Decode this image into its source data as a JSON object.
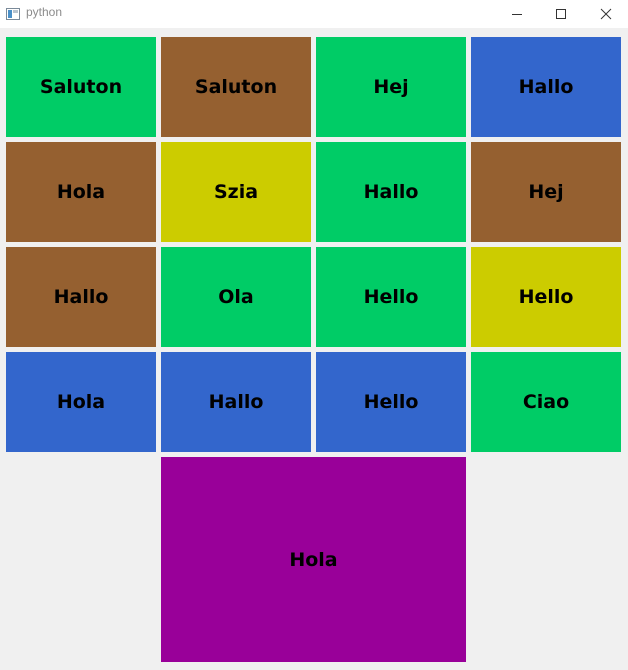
{
  "window": {
    "title": "python",
    "icons": {
      "app": "python-app-icon",
      "minimize": "minimize-icon",
      "maximize": "maximize-icon",
      "close": "close-icon"
    }
  },
  "colors": {
    "green": "#00cc66",
    "brown": "#956030",
    "blue": "#3366cc",
    "yellow": "#cccc00",
    "purple": "#990099",
    "background": "#f0f0f0"
  },
  "tiles": [
    {
      "label": "Saluton",
      "color": "#00cc66"
    },
    {
      "label": "Saluton",
      "color": "#956030"
    },
    {
      "label": "Hej",
      "color": "#00cc66"
    },
    {
      "label": "Hallo",
      "color": "#3366cc"
    },
    {
      "label": "Hola",
      "color": "#956030"
    },
    {
      "label": "Szia",
      "color": "#cccc00"
    },
    {
      "label": "Hallo",
      "color": "#00cc66"
    },
    {
      "label": "Hej",
      "color": "#956030"
    },
    {
      "label": "Hallo",
      "color": "#956030"
    },
    {
      "label": "Ola",
      "color": "#00cc66"
    },
    {
      "label": "Hello",
      "color": "#00cc66"
    },
    {
      "label": "Hello",
      "color": "#cccc00"
    },
    {
      "label": "Hola",
      "color": "#3366cc"
    },
    {
      "label": "Hallo",
      "color": "#3366cc"
    },
    {
      "label": "Hello",
      "color": "#3366cc"
    },
    {
      "label": "Ciao",
      "color": "#00cc66"
    },
    {
      "label": "Hola",
      "color": "#990099"
    }
  ]
}
